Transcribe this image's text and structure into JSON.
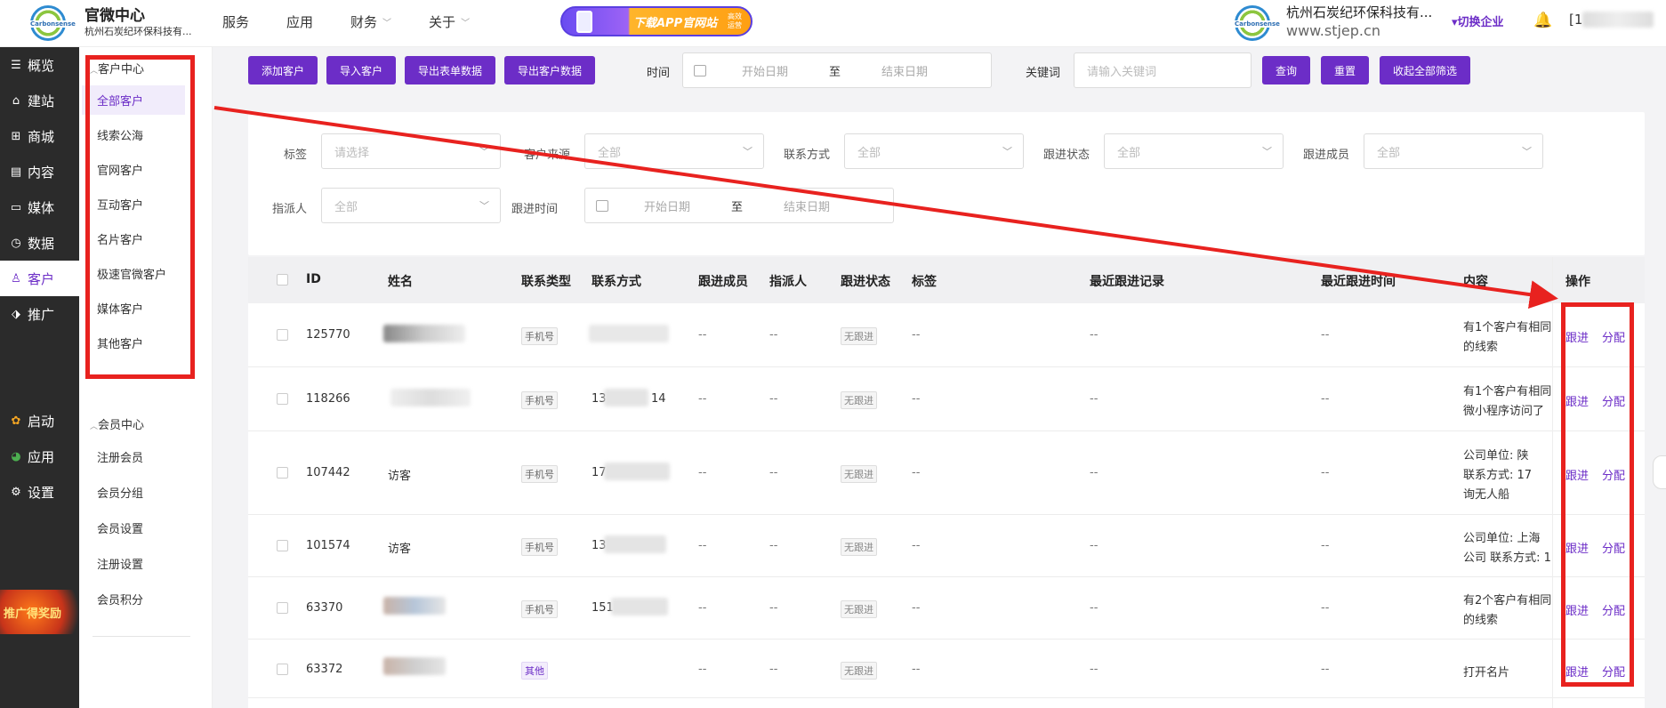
{
  "header": {
    "logo_text": "Carbonsense",
    "title": "官微中心",
    "subtitle": "杭州石炭纪环保科技有...",
    "nav": [
      {
        "label": "服务",
        "dropdown": false
      },
      {
        "label": "应用",
        "dropdown": false
      },
      {
        "label": "财务",
        "dropdown": true
      },
      {
        "label": "关于",
        "dropdown": true
      }
    ],
    "banner_text": "下载APP官网站",
    "banner_sub": "高效\n运营",
    "company_name": "杭州石炭纪环保科技有...",
    "company_site": "www.stjep.cn",
    "switch_label": "切换企业",
    "user_prefix": "[1"
  },
  "rail": [
    {
      "label": "概览",
      "icon": "overview-icon",
      "glyph": "☰"
    },
    {
      "label": "建站",
      "icon": "home-icon",
      "glyph": "⌂"
    },
    {
      "label": "商城",
      "icon": "cart-icon",
      "glyph": "⊞"
    },
    {
      "label": "内容",
      "icon": "document-icon",
      "glyph": "▤"
    },
    {
      "label": "媒体",
      "icon": "video-icon",
      "glyph": "▭"
    },
    {
      "label": "数据",
      "icon": "clock-icon",
      "glyph": "◷"
    },
    {
      "label": "客户",
      "icon": "user-icon",
      "glyph": "♙",
      "active": true
    },
    {
      "label": "推广",
      "icon": "tag-icon",
      "glyph": "⬗"
    },
    {
      "label": "启动",
      "icon": "launch-icon",
      "glyph": "✿"
    },
    {
      "label": "应用",
      "icon": "apps-icon",
      "glyph": "◕"
    },
    {
      "label": "设置",
      "icon": "gear-icon",
      "glyph": "⚙"
    }
  ],
  "promo_text": "推广得奖励",
  "subnav": {
    "group1": "客户中心",
    "group1_items": [
      "全部客户",
      "线索公海",
      "官网客户",
      "互动客户",
      "名片客户",
      "极速官微客户",
      "媒体客户",
      "其他客户"
    ],
    "group2": "会员中心",
    "group2_items": [
      "注册会员",
      "会员分组",
      "会员设置",
      "注册设置",
      "会员积分"
    ]
  },
  "toolbar": {
    "buttons": [
      "添加客户",
      "导入客户",
      "导出表单数据",
      "导出客户数据"
    ],
    "time_label": "时间",
    "start_date": "开始日期",
    "to": "至",
    "end_date": "结束日期",
    "keyword_label": "关键词",
    "keyword_placeholder": "请输入关键词",
    "query": "查询",
    "reset": "重置",
    "collapse": "收起全部筛选"
  },
  "filters": {
    "tag_label": "标签",
    "tag_placeholder": "请选择",
    "source_label": "客户来源",
    "source_value": "全部",
    "contact_label": "联系方式",
    "contact_value": "全部",
    "status_label": "跟进状态",
    "status_value": "全部",
    "member_label": "跟进成员",
    "member_value": "全部",
    "assigner_label": "指派人",
    "assigner_value": "全部",
    "follow_time_label": "跟进时间",
    "start_date": "开始日期",
    "to": "至",
    "end_date": "结束日期"
  },
  "table": {
    "headers": {
      "id": "ID",
      "name": "姓名",
      "contact_type": "联系类型",
      "contact": "联系方式",
      "member": "跟进成员",
      "assigner": "指派人",
      "status": "跟进状态",
      "tag": "标签",
      "last_record": "最近跟进记录",
      "last_time": "最近跟进时间",
      "content": "内容",
      "ops": "操作"
    },
    "rows": [
      {
        "id": "125770",
        "name": "",
        "contact_type": "手机号",
        "contact": "",
        "member": "--",
        "assigner": "--",
        "status": "无跟进",
        "tag": "--",
        "last_record": "--",
        "last_time": "--",
        "content1": "有1个客户有相同",
        "content2": "的线索",
        "content3": "",
        "op1": "跟进",
        "op2": "分配"
      },
      {
        "id": "118266",
        "name": "",
        "contact_type": "手机号",
        "contact": "13",
        "contact_tail": "14",
        "member": "--",
        "assigner": "--",
        "status": "无跟进",
        "tag": "--",
        "last_record": "--",
        "last_time": "--",
        "content1": "有1个客户有相同",
        "content2": "微小程序访问了",
        "content3": "",
        "op1": "跟进",
        "op2": "分配"
      },
      {
        "id": "107442",
        "name": "访客",
        "contact_type": "手机号",
        "contact": "17",
        "member": "--",
        "assigner": "--",
        "status": "无跟进",
        "tag": "--",
        "last_record": "--",
        "last_time": "--",
        "content1": "公司单位: 陕",
        "content2": "联系方式: 17",
        "content3": "询无人船",
        "op1": "跟进",
        "op2": "分配"
      },
      {
        "id": "101574",
        "name": "访客",
        "contact_type": "手机号",
        "contact": "13",
        "member": "--",
        "assigner": "--",
        "status": "无跟进",
        "tag": "--",
        "last_record": "--",
        "last_time": "--",
        "content1": "公司单位: 上海",
        "content2": "公司 联系方式: 1",
        "content3": "",
        "op1": "跟进",
        "op2": "分配"
      },
      {
        "id": "63370",
        "name": "",
        "contact_type": "手机号",
        "contact": "151",
        "member": "--",
        "assigner": "--",
        "status": "无跟进",
        "tag": "--",
        "last_record": "--",
        "last_time": "--",
        "content1": "有2个客户有相同",
        "content2": "的线索",
        "content3": "",
        "op1": "跟进",
        "op2": "分配"
      },
      {
        "id": "63372",
        "name": "",
        "contact_type": "其他",
        "contact": "",
        "member": "--",
        "assigner": "--",
        "status": "无跟进",
        "tag": "--",
        "last_record": "--",
        "last_time": "--",
        "content1": "打开名片",
        "content2": "",
        "content3": "",
        "op1": "跟进",
        "op2": "分配"
      }
    ]
  },
  "colors": {
    "accent": "#6c2dc7",
    "annotation": "#e8221f",
    "rail": "#2b2b2b"
  }
}
